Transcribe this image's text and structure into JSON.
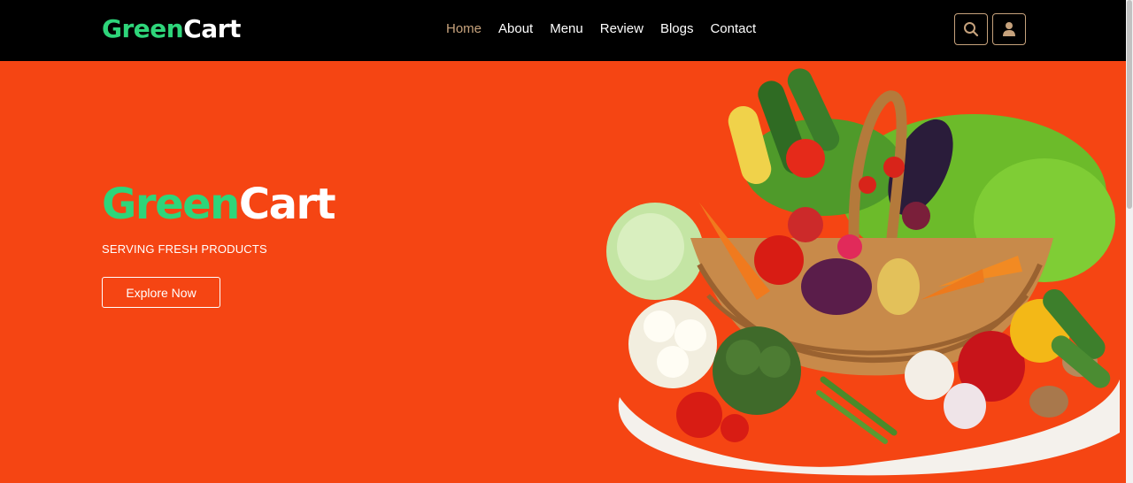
{
  "brand": {
    "part1": "Green",
    "part2": "Cart"
  },
  "nav": {
    "items": [
      {
        "label": "Home",
        "active": true
      },
      {
        "label": "About"
      },
      {
        "label": "Menu"
      },
      {
        "label": "Review"
      },
      {
        "label": "Blogs"
      },
      {
        "label": "Contact"
      }
    ]
  },
  "header_icons": {
    "search": "search-icon",
    "user": "user-icon"
  },
  "hero": {
    "title_part1": "Green",
    "title_part2": "Cart",
    "tagline": "SERVING FRESH PRODUCTS",
    "cta_label": "Explore Now",
    "image": "vegetable-basket"
  },
  "colors": {
    "background": "#f54513",
    "header": "#000000",
    "brand_green": "#2ed57a",
    "accent": "#c6a27c"
  }
}
